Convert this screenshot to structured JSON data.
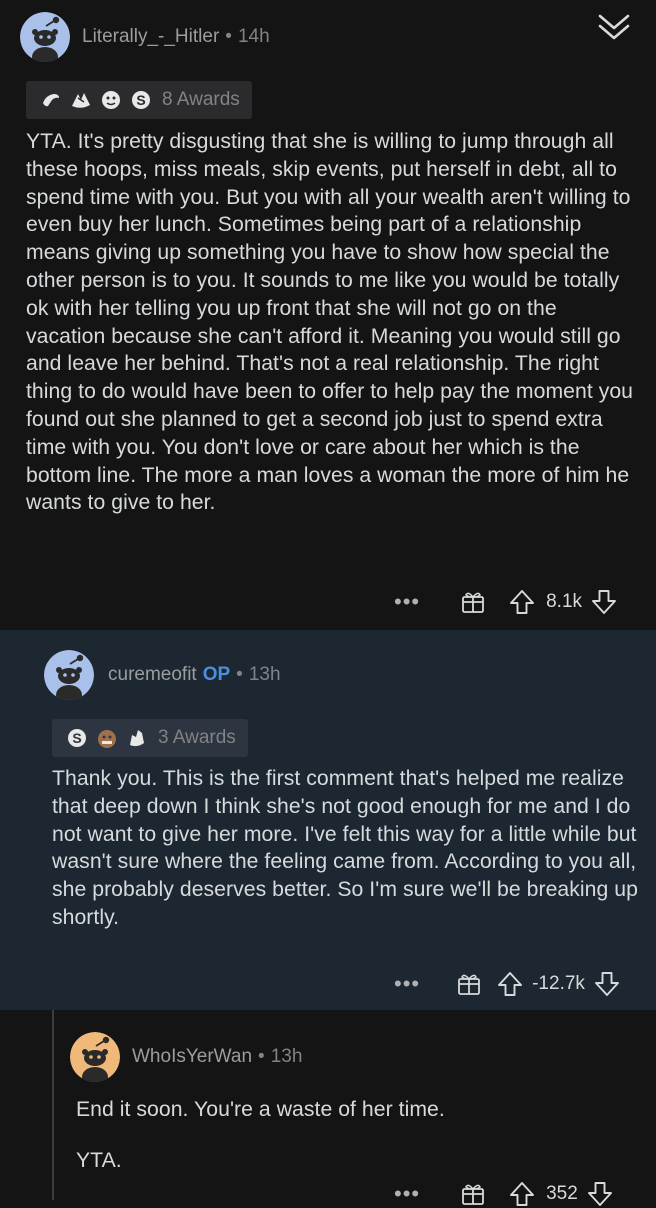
{
  "comments": [
    {
      "username": "Literally_-_Hitler",
      "time": "14h",
      "awards_label": "8 Awards",
      "body": "YTA. It's pretty disgusting that she is willing to jump through all these hoops, miss meals, skip events, put herself in debt, all to spend time with you. But you with all your wealth aren't willing to even buy her lunch. Sometimes being part of a relationship means giving up something you have to show how special the other person is to you. It sounds to me like you would be totally ok with her telling you up front that she will not go on the vacation because she can't afford it. Meaning you would still go and leave her behind. That's not a real relationship. The right thing to do would have been to offer to help pay the moment you found out she planned to get a second job just to spend extra time with you. You don't love or care about her which is the bottom line. The more a man loves a woman the more of him he wants to give to her.",
      "score": "8.1k",
      "avatar_color": "#a9c0ea"
    },
    {
      "username": "curemeofit",
      "op_label": "OP",
      "time": "13h",
      "awards_label": "3 Awards",
      "body": "Thank you. This is the first comment that's helped me realize that deep down I think she's not good enough for me and I do not want to give her more. I've felt this way for a little while but wasn't sure where the feeling came from. According to you all, she probably deserves better. So I'm sure we'll be breaking up shortly.",
      "score": "-12.7k",
      "avatar_color": "#a9c0ea"
    },
    {
      "username": "WhoIsYerWan",
      "time": "13h",
      "body_paragraphs": [
        "End it soon. You're a waste of her time.",
        "YTA."
      ],
      "score": "352",
      "avatar_color": "#f0b97a"
    }
  ],
  "separator": "•",
  "more_glyph": "•••",
  "icons": [
    "collapse-chevron-icon",
    "award-gift-icon",
    "upvote-arrow-icon",
    "downvote-arrow-icon",
    "snoo-avatar-icon",
    "more-options-icon"
  ],
  "colors": {
    "op_badge": "#4a8fe0",
    "highlight_bg": "#1d2731",
    "page_bg": "#141414"
  }
}
